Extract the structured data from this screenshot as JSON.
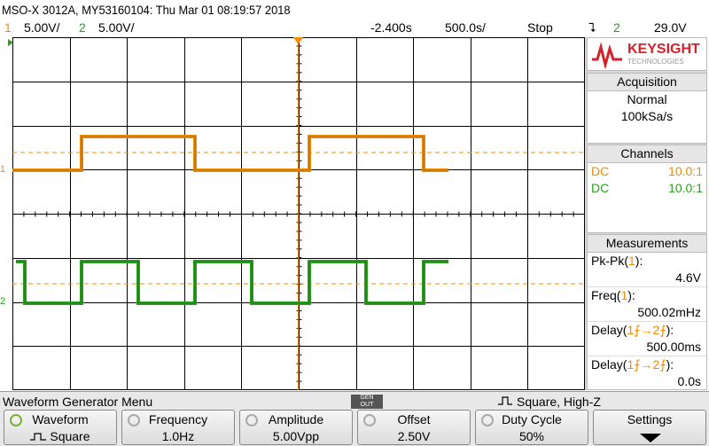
{
  "header": {
    "title": "MSO-X 3012A, MY53160104: Thu Mar 01 08:19:57 2018",
    "ch1_num": "1",
    "ch1_scale": "5.00V/",
    "ch2_num": "2",
    "ch2_scale": "5.00V/",
    "time_offset": "-2.400s",
    "time_scale": "500.0s/",
    "run_state": "Stop",
    "trigger_symbol": "⮧",
    "trigger_channel": "2",
    "trigger_level": "29.0V"
  },
  "markers": {
    "ch1": "1",
    "ch2": "2"
  },
  "brand": {
    "name": "KEYSIGHT",
    "sub": "TECHNOLOGIES"
  },
  "acquisition": {
    "title": "Acquisition",
    "mode": "Normal",
    "rate": "100kSa/s"
  },
  "channels": {
    "title": "Channels",
    "rows": [
      {
        "coupling": "DC",
        "probe": "10.0:1"
      },
      {
        "coupling": "DC",
        "probe": "10.0:1"
      }
    ]
  },
  "measurements": {
    "title": "Measurements",
    "items": [
      {
        "label": "Pk-Pk(",
        "src": "1",
        "tail": "):",
        "value": "4.6V"
      },
      {
        "label": "Freq(",
        "src": "1",
        "tail": "):",
        "value": "500.02mHz"
      },
      {
        "label": "Delay(",
        "src": "1⨍→2⨍",
        "tail": "):",
        "value": "500.00ms"
      },
      {
        "label": "Delay(",
        "src": "1⨍→2⨍",
        "tail": "):",
        "value": "0.0s"
      }
    ]
  },
  "menu": {
    "title": "Waveform Generator Menu",
    "gen_label_1": "GEN",
    "gen_label_2": "OUT",
    "status": "Square, High-Z",
    "softkeys": [
      {
        "label": "Waveform",
        "value": "Square"
      },
      {
        "label": "Frequency",
        "value": "1.0Hz"
      },
      {
        "label": "Amplitude",
        "value": "5.00Vpp"
      },
      {
        "label": "Offset",
        "value": "2.50V"
      },
      {
        "label": "Duty Cycle",
        "value": "50%"
      },
      {
        "label": "Settings",
        "value": ""
      }
    ]
  },
  "colors": {
    "ch1": "#f08c00",
    "ch2": "#2aa01e",
    "grid": "#000000",
    "panel": "#d8d8d8"
  }
}
